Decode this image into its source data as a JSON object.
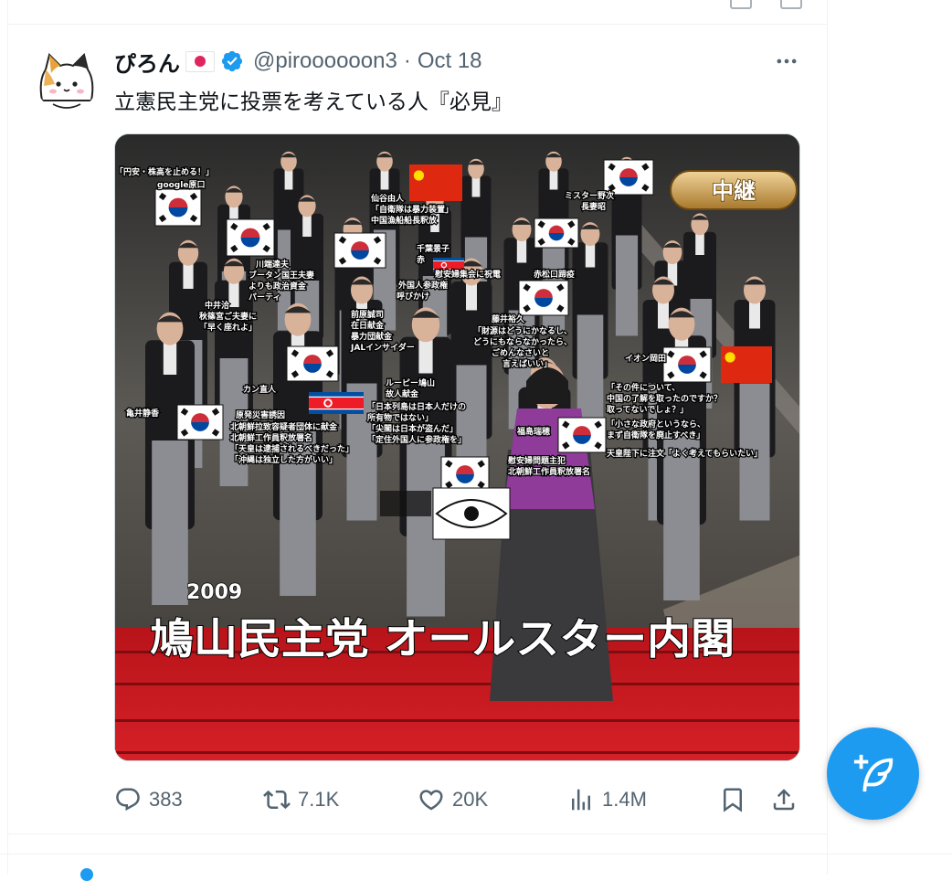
{
  "tweet": {
    "display_name": "ぴろん",
    "handle": "@piroooooon3",
    "separator": "·",
    "date": "Oct 18",
    "text": "立憲民主党に投票を考えている人『必見』"
  },
  "media": {
    "badge": "中継",
    "year": "2009",
    "title": "鳩山民主党 オールスター内閣",
    "captions": [
      "「円安・株高を止める！」",
      "google原口",
      "仙谷由人",
      "「自衛隊は暴力装置」",
      "中国漁船船長釈放",
      "ミスター野次",
      "長妻昭",
      "川端達夫",
      "ブータン国王夫妻",
      "よりも政治資金",
      "パーティ",
      "千葉景子",
      "赤",
      "慰安婦集会に祝電",
      "外国人参政権",
      "呼びかけ",
      "赤松口蹄疫",
      "中井洽",
      "秋篠宮ご夫妻に",
      "「早く座れよ」",
      "前原誠司",
      "在日献金",
      "暴力団献金",
      "JALインサイダー",
      "藤井裕久",
      "「財源はどうにかなるし、",
      "どうにもならなかったら、",
      "ごめんなさいと",
      "言えばいい」",
      "イオン岡田",
      "カン直人",
      "ルーピー鳩山",
      "故人献金",
      "「日本列島は日本人だけの",
      "所有物ではない」",
      "「尖閣は日本が盗んだ」",
      "「定住外国人に参政権を」",
      "亀井静香",
      "原発災害誘因",
      "北朝鮮拉致容疑者団体に献金",
      "北朝鮮工作員釈放署名",
      "「天皇は逮捕されるべきだった」",
      "「沖縄は独立した方がいい」",
      "福島瑞穂",
      "慰安婦問題主犯",
      "北朝鮮工作員釈放署名",
      "「その件について、",
      "中国の了解を取ったのですか？",
      "取ってないでしょ？」",
      "「小さな政府というなら、",
      "まず自衛隊を廃止すべき」",
      "天皇陛下に注文「よく考えてもらいたい」"
    ]
  },
  "actions": {
    "replies": "383",
    "reposts": "7.1K",
    "likes": "20K",
    "views": "1.4M"
  },
  "colors": {
    "accent": "#1d9bf0",
    "text_primary": "#0f1419",
    "text_secondary": "#536471",
    "border": "#eff3f4"
  },
  "icons": {
    "more": "more-icon",
    "reply": "reply-icon",
    "repost": "repost-icon",
    "like": "like-icon",
    "views": "views-icon",
    "bookmark": "bookmark-icon",
    "share": "share-icon",
    "compose": "compose-icon",
    "verified": "verified-badge-icon"
  }
}
